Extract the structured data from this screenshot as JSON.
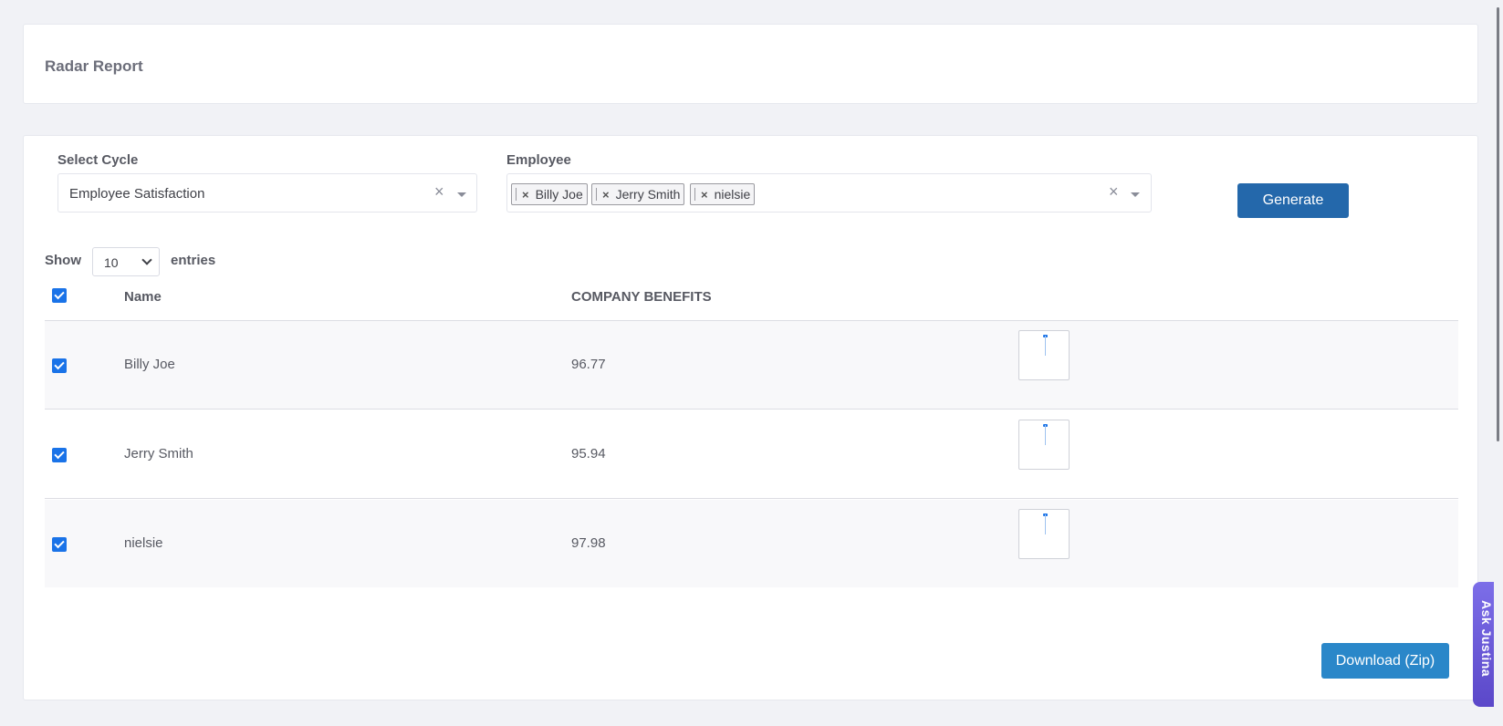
{
  "page": {
    "title": "Radar Report"
  },
  "filters": {
    "cycle_label": "Select Cycle",
    "cycle_value": "Employee Satisfaction",
    "employee_label": "Employee",
    "employees": [
      "Billy Joe",
      "Jerry Smith",
      "nielsie"
    ],
    "clear_glyph": "×",
    "tag_remove_glyph": "×",
    "generate_label": "Generate"
  },
  "table_controls": {
    "show_label": "Show",
    "length_value": "10",
    "entries_label": "entries"
  },
  "table": {
    "headers": [
      "Name",
      "COMPANY BENEFITS"
    ],
    "rows": [
      {
        "name": "Billy Joe",
        "score": "96.77"
      },
      {
        "name": "Jerry Smith",
        "score": "95.94"
      },
      {
        "name": "nielsie",
        "score": "97.98"
      }
    ]
  },
  "download_label": "Download (Zip)",
  "assistant_tab": "Ask Justina",
  "colors": {
    "primary": "#2468ab",
    "download": "#2a87c9",
    "checkbox": "#1a73e8",
    "assistant": "#6a5be0"
  }
}
